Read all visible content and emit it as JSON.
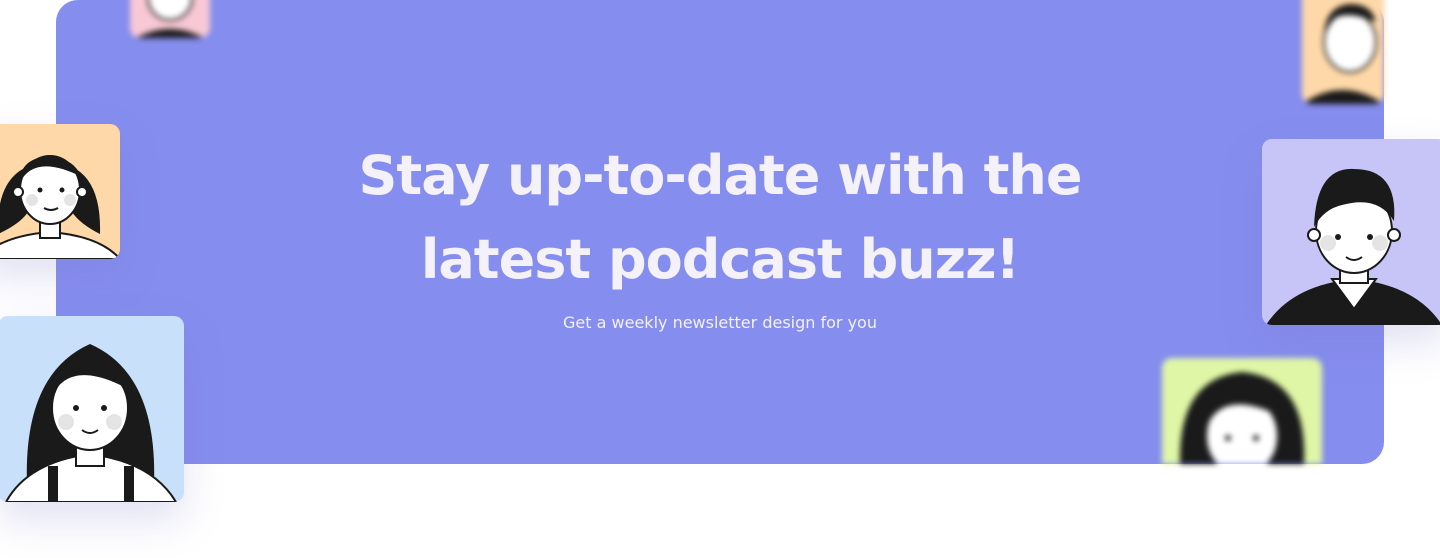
{
  "hero": {
    "headline_line1": "Stay up-to-date with the",
    "headline_line2": "latest podcast buzz!",
    "subheadline": "Get a weekly newsletter design for you"
  },
  "colors": {
    "banner_bg": "#858dee",
    "text": "#f4f1f8",
    "avatar_orange": "#fed8a8",
    "avatar_blue": "#c9e0fb",
    "avatar_lavender": "#c7c5f8",
    "avatar_green": "#dff6a6",
    "avatar_pink": "#f8c8d4"
  },
  "avatars": [
    {
      "name": "avatar-top-left-pink",
      "icon": "person-avatar-icon"
    },
    {
      "name": "avatar-left-orange",
      "icon": "woman-short-hair-icon"
    },
    {
      "name": "avatar-left-blue",
      "icon": "woman-long-hair-icon"
    },
    {
      "name": "avatar-top-right-orange",
      "icon": "man-avatar-icon"
    },
    {
      "name": "avatar-right-lavender",
      "icon": "man-striped-shirt-icon"
    },
    {
      "name": "avatar-bottom-right-green",
      "icon": "woman-avatar-icon"
    }
  ]
}
